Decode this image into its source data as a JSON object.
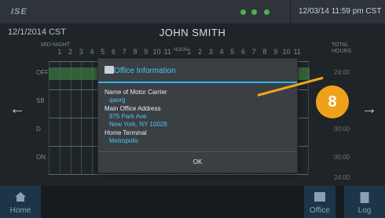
{
  "header": {
    "logo": "ISE",
    "datetime": "12/03/14 11:59 pm CST",
    "status_icons": [
      "diamond-icon",
      "circle-icon",
      "gps-icon"
    ],
    "status_color": "#4caf50"
  },
  "log": {
    "date": "12/1/2014 CST",
    "driver_name": "JOHN SMITH",
    "midnight_label": "MID-NIGHT",
    "total_hours_label": "TOTAL HOURS",
    "hour_ticks": [
      "1",
      "2",
      "3",
      "4",
      "5",
      "6",
      "7",
      "8",
      "9",
      "10",
      "11",
      "NOON",
      "1",
      "2",
      "3",
      "4",
      "5",
      "6",
      "7",
      "8",
      "9",
      "10",
      "11"
    ],
    "rows": [
      {
        "status": "OFF",
        "total": "24:00"
      },
      {
        "status": "SB",
        "total": ""
      },
      {
        "status": "D",
        "total": "00:00"
      },
      {
        "status": "ON",
        "total": "00:00"
      }
    ],
    "grand_total": "24:00"
  },
  "modal": {
    "title": "Office Information",
    "icon": "briefcase-icon",
    "fields": [
      {
        "label": "Name of Motor Carrier",
        "values": [
          "qaorg"
        ]
      },
      {
        "label": "Main Office Address",
        "values": [
          "975 Park Ave",
          "New York, NY 10028"
        ]
      },
      {
        "label": "Home Terminal",
        "values": [
          "Metropolis"
        ]
      }
    ],
    "ok_label": "OK"
  },
  "annotation": {
    "number": "8",
    "color": "#f0a11b"
  },
  "bottom_nav": {
    "home_label": "Home",
    "office_label": "Office",
    "log_label": "Log"
  }
}
